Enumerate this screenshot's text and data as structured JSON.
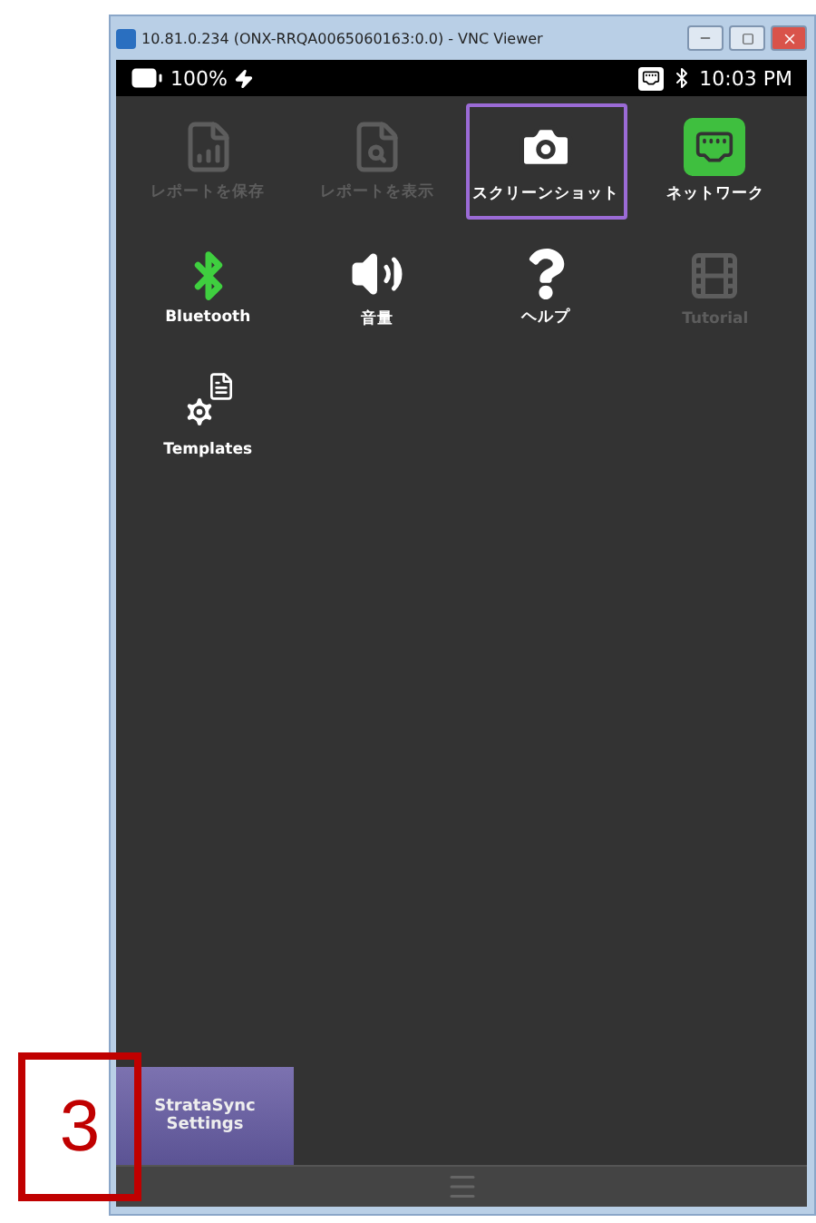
{
  "window": {
    "title": "10.81.0.234 (ONX-RRQA0065060163:0.0) - VNC Viewer"
  },
  "status_bar": {
    "battery": "100%",
    "time": "10:03 PM"
  },
  "tiles": [
    {
      "label": "レポートを保存",
      "kind": "report-save",
      "disabled": true,
      "selected": false
    },
    {
      "label": "レポートを表示",
      "kind": "report-view",
      "disabled": true,
      "selected": false
    },
    {
      "label": "スクリーンショット",
      "kind": "camera",
      "disabled": false,
      "selected": true
    },
    {
      "label": "ネットワーク",
      "kind": "network",
      "disabled": false,
      "selected": false
    },
    {
      "label": "Bluetooth",
      "kind": "bluetooth",
      "disabled": false,
      "selected": false
    },
    {
      "label": "音量",
      "kind": "volume",
      "disabled": false,
      "selected": false
    },
    {
      "label": "ヘルプ",
      "kind": "help",
      "disabled": false,
      "selected": false
    },
    {
      "label": "Tutorial",
      "kind": "film",
      "disabled": true,
      "selected": false
    },
    {
      "label": "Templates",
      "kind": "templates",
      "disabled": false,
      "selected": false
    }
  ],
  "bottom_button": {
    "label": "StrataSync Settings"
  },
  "callout": {
    "label": "3"
  }
}
